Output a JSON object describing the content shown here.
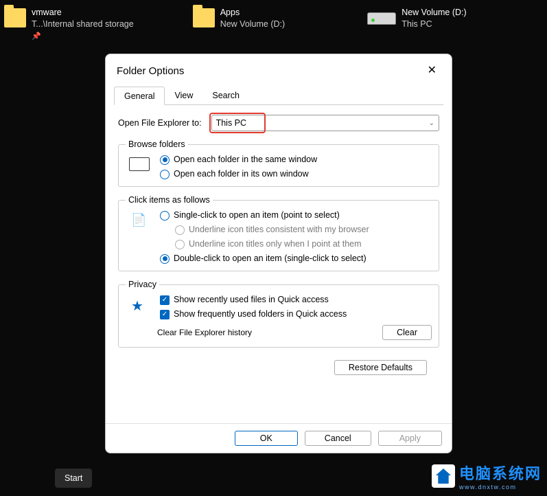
{
  "desktop": {
    "items": [
      {
        "name": "vmware",
        "sub": "T...\\Internal shared storage",
        "pinned": true,
        "type": "folder"
      },
      {
        "name": "Apps",
        "sub": "New Volume (D:)",
        "pinned": false,
        "type": "folder"
      },
      {
        "name": "New Volume (D:)",
        "sub": "This PC",
        "pinned": false,
        "type": "drive"
      }
    ]
  },
  "dialog": {
    "title": "Folder Options",
    "tabs": [
      "General",
      "View",
      "Search"
    ],
    "active_tab": "General",
    "open_to_label": "Open File Explorer to:",
    "open_to_value": "This PC",
    "browse": {
      "legend": "Browse folders",
      "opt1": "Open each folder in the same window",
      "opt2": "Open each folder in its own window",
      "selected": 0
    },
    "click": {
      "legend": "Click items as follows",
      "single": "Single-click to open an item (point to select)",
      "underline_browser": "Underline icon titles consistent with my browser",
      "underline_point": "Underline icon titles only when I point at them",
      "double": "Double-click to open an item (single-click to select)",
      "selected": "double"
    },
    "privacy": {
      "legend": "Privacy",
      "recent": "Show recently used files in Quick access",
      "frequent": "Show frequently used folders in Quick access",
      "clear_label": "Clear File Explorer history",
      "clear_btn": "Clear"
    },
    "restore": "Restore Defaults",
    "ok": "OK",
    "cancel": "Cancel",
    "apply": "Apply"
  },
  "taskbar": {
    "start": "Start"
  },
  "watermark": {
    "main": "电脑系统网",
    "sub": "www.dnxtw.com"
  }
}
